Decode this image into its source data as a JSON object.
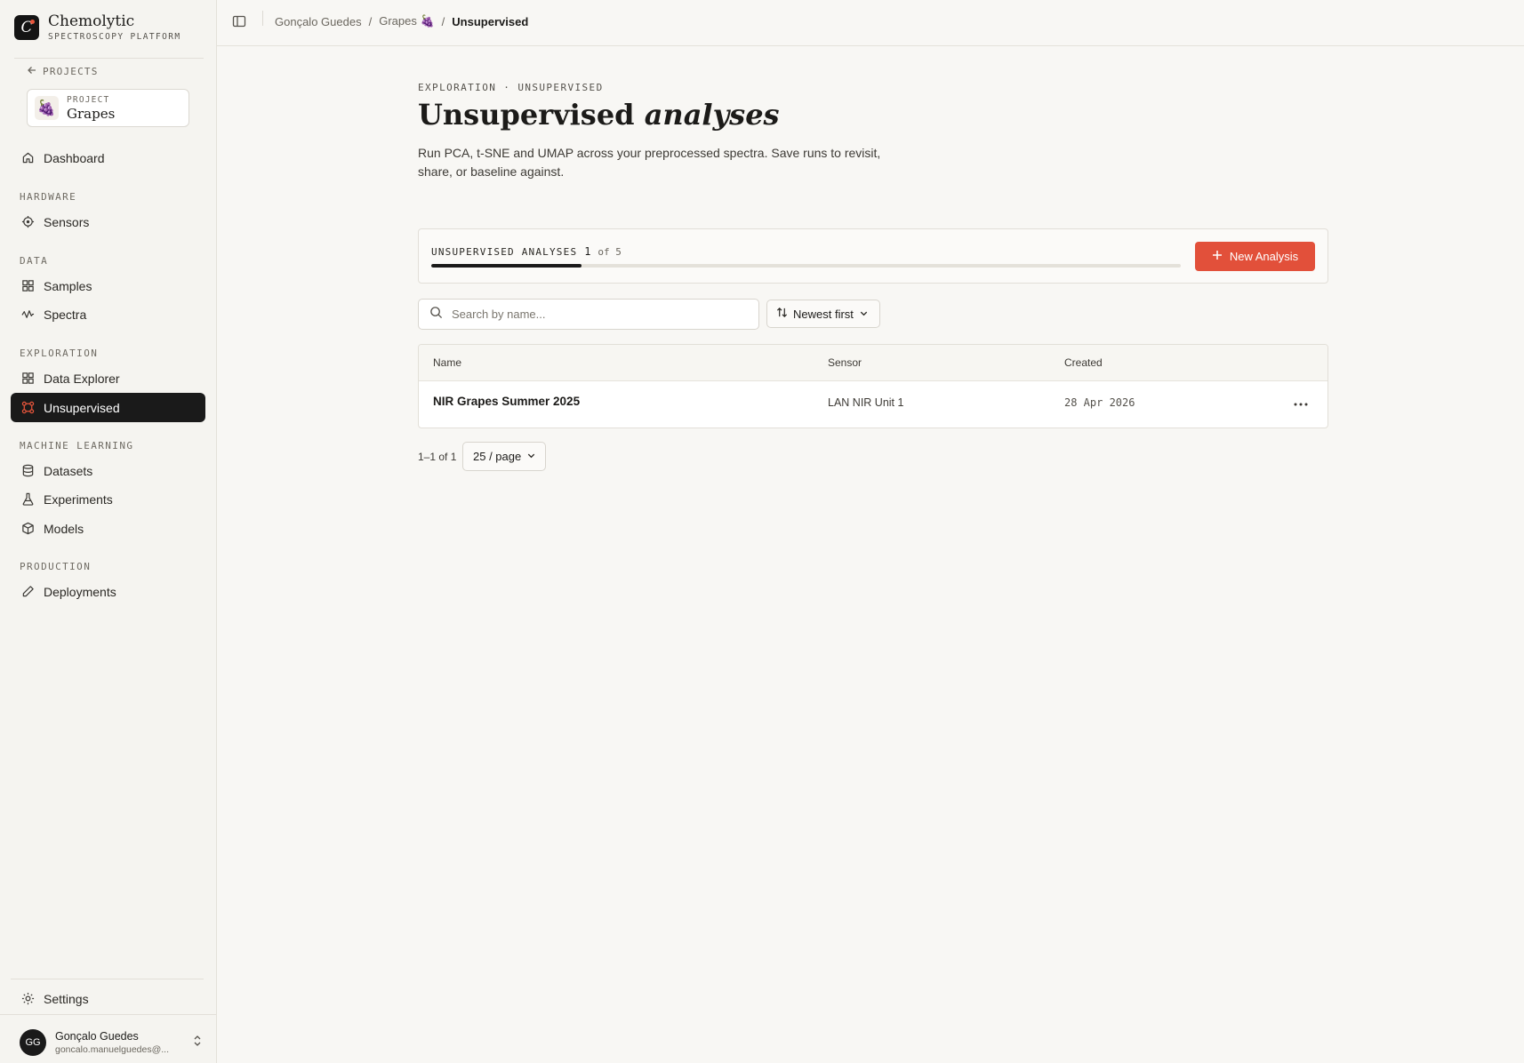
{
  "brand": {
    "name": "Chemolytic",
    "subtitle": "SPECTROSCOPY PLATFORM",
    "logo_letter": "C"
  },
  "sidebar": {
    "back_label": "PROJECTS",
    "project": {
      "label": "PROJECT",
      "name": "Grapes",
      "emoji": "🍇"
    },
    "dashboard": "Dashboard",
    "sections": {
      "hardware": "HARDWARE",
      "data": "DATA",
      "exploration": "EXPLORATION",
      "machine_learning": "MACHINE LEARNING",
      "production": "PRODUCTION"
    },
    "items": {
      "sensors": "Sensors",
      "samples": "Samples",
      "spectra": "Spectra",
      "data_explorer": "Data Explorer",
      "unsupervised": "Unsupervised",
      "datasets": "Datasets",
      "experiments": "Experiments",
      "models": "Models",
      "deployments": "Deployments",
      "settings": "Settings"
    },
    "active_item": "Unsupervised",
    "user": {
      "initials": "GG",
      "name": "Gonçalo Guedes",
      "email": "goncalo.manuelguedes@..."
    }
  },
  "breadcrumb": {
    "user": "Gonçalo Guedes",
    "project": "Grapes",
    "project_emoji": "🍇",
    "separator": "/",
    "current": "Unsupervised"
  },
  "header": {
    "eyebrow": "EXPLORATION · UNSUPERVISED",
    "title_main": "Unsupervised",
    "title_em": "analyses",
    "description": "Run PCA, t-SNE and UMAP across your preprocessed spectra. Save runs to revisit, share, or baseline against."
  },
  "quota": {
    "label": "UNSUPERVISED ANALYSES",
    "used": "1",
    "of_text": "of 5",
    "used_fraction": 0.2,
    "new_button": "New Analysis"
  },
  "search": {
    "placeholder": "Search by name...",
    "value": ""
  },
  "sort": {
    "label": "Newest first"
  },
  "table": {
    "columns": {
      "name": "Name",
      "sensor": "Sensor",
      "created": "Created"
    },
    "rows": [
      {
        "name": "NIR Grapes Summer 2025",
        "sensor": "LAN NIR Unit 1",
        "created": "28 Apr 2026"
      }
    ]
  },
  "pagination": {
    "range": "1–1 of 1",
    "page_size": "25 / page"
  },
  "colors": {
    "accent": "#e2503a",
    "active_bg": "#1a1a1a",
    "background": "#f8f7f4"
  }
}
